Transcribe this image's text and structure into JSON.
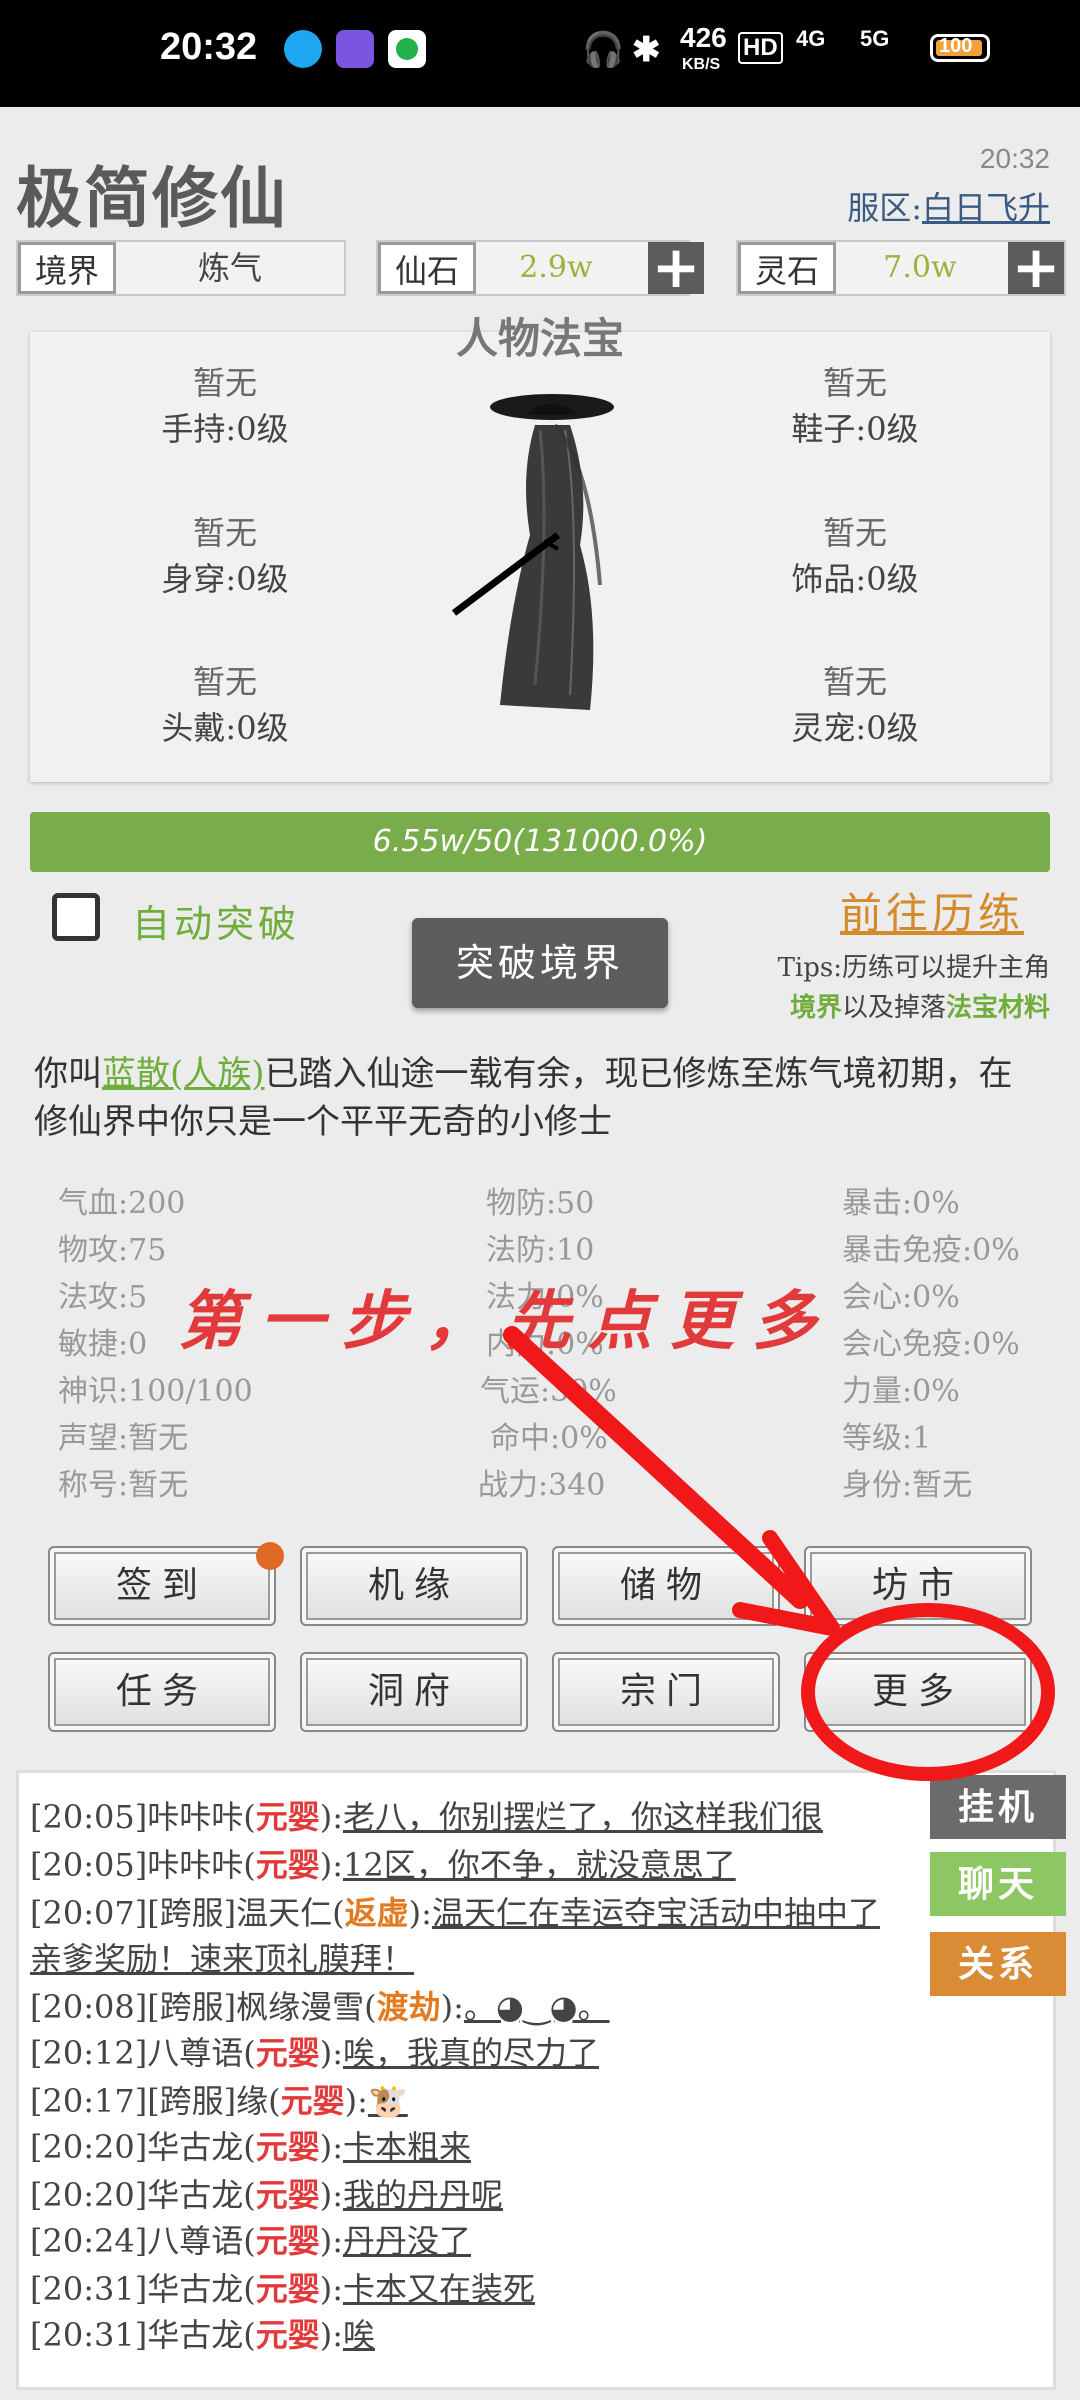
{
  "status_bar": {
    "time": "20:32",
    "net_speed": "426",
    "net_unit": "KB/S",
    "hd": "HD",
    "signal1": "4G",
    "signal2": "5G",
    "battery": "100"
  },
  "header": {
    "title": "极简修仙",
    "clock": "20:32",
    "server_label": "服区:",
    "server_name": "白日飞升"
  },
  "resources": {
    "realm_label": "境界",
    "realm_value": "炼气",
    "immortal_stone_label": "仙石",
    "immortal_stone_value": "2.9w",
    "spirit_stone_label": "灵石",
    "spirit_stone_value": "7.0w"
  },
  "equipment": {
    "title": "人物法宝",
    "slots": [
      {
        "status": "暂无",
        "label": "手持:0级"
      },
      {
        "status": "暂无",
        "label": "鞋子:0级"
      },
      {
        "status": "暂无",
        "label": "身穿:0级"
      },
      {
        "status": "暂无",
        "label": "饰品:0级"
      },
      {
        "status": "暂无",
        "label": "头戴:0级"
      },
      {
        "status": "暂无",
        "label": "灵宠:0级"
      }
    ]
  },
  "progress": {
    "text": "6.55w/50(131000.0%)",
    "fraction": 1.0
  },
  "actions": {
    "auto_breakthrough": "自动突破",
    "breakthrough": "突破境界",
    "go_train": "前往历练",
    "tips_line1": "Tips:历练可以提升主角",
    "tips_realm": "境界",
    "tips_mid": "以及掉落",
    "tips_material": "法宝材料"
  },
  "story": {
    "prefix": "你叫",
    "name": "蓝散(人族)",
    "rest": "已踏入仙途一载有余，现已修炼至炼气境初期，在修仙界中你只是一个平平无奇的小修士"
  },
  "stats": {
    "col1": [
      "气血:200",
      "物攻:75",
      "法攻:5",
      "敏捷:0",
      "神识:100/100",
      "声望:暂无",
      "称号:暂无"
    ],
    "col2": [
      "物防:50",
      "法防:10",
      "法力:0%",
      "内力:0%",
      "气运:30%",
      "命中:0%",
      "战力:340"
    ],
    "col3": [
      "暴击:0%",
      "暴击免疫:0%",
      "会心:0%",
      "会心免疫:0%",
      "力量:0%",
      "等级:1",
      "身份:暂无"
    ]
  },
  "overlay": {
    "text": "第一步，先点更多"
  },
  "menu": [
    "签到",
    "机缘",
    "储物",
    "坊市",
    "任务",
    "洞府",
    "宗门",
    "更多"
  ],
  "chat": {
    "lines": [
      {
        "prefix": "[20:05]咔咔咔(",
        "rank": "元婴",
        "rank_color": "red",
        "msg": "老八，你别摆烂了，你这样我们很"
      },
      {
        "prefix": "[20:05]咔咔咔(",
        "rank": "元婴",
        "rank_color": "red",
        "msg": "12区，你不争，就没意思了"
      },
      {
        "prefix": "[20:07][跨服]温天仁(",
        "rank": "返虚",
        "rank_color": "orange",
        "msg": "温天仁在幸运夺宝活动中抽中了"
      },
      {
        "prefix": "",
        "rank": "",
        "rank_color": "",
        "msg": "亲爹奖励！速来顶礼膜拜！"
      },
      {
        "prefix": "[20:08][跨服]枫缘漫雪(",
        "rank": "渡劫",
        "rank_color": "orange",
        "msg": "。◕‿◕。"
      },
      {
        "prefix": "[20:12]八尊语(",
        "rank": "元婴",
        "rank_color": "red",
        "msg": "唉，我真的尽力了"
      },
      {
        "prefix": "[20:17][跨服]缘(",
        "rank": "元婴",
        "rank_color": "red",
        "msg": "🐮"
      },
      {
        "prefix": "[20:20]华古龙(",
        "rank": "元婴",
        "rank_color": "red",
        "msg": "卡本粗来"
      },
      {
        "prefix": "[20:20]华古龙(",
        "rank": "元婴",
        "rank_color": "red",
        "msg": "我的丹丹呢"
      },
      {
        "prefix": "[20:24]八尊语(",
        "rank": "元婴",
        "rank_color": "red",
        "msg": "丹丹没了"
      },
      {
        "prefix": "[20:31]华古龙(",
        "rank": "元婴",
        "rank_color": "red",
        "msg": "卡本又在装死"
      },
      {
        "prefix": "[20:31]华古龙(",
        "rank": "元婴",
        "rank_color": "red",
        "msg": "唉"
      }
    ],
    "side_buttons": [
      {
        "label": "挂机",
        "color": "#6b6b6b"
      },
      {
        "label": "聊天",
        "color": "#8cc763"
      },
      {
        "label": "关系",
        "color": "#d98b36"
      }
    ]
  },
  "colors": {
    "progress": "#79ad4b",
    "annotation": "#e23a3a",
    "accent_green": "#6fae3b",
    "accent_orange": "#d28a2b"
  }
}
